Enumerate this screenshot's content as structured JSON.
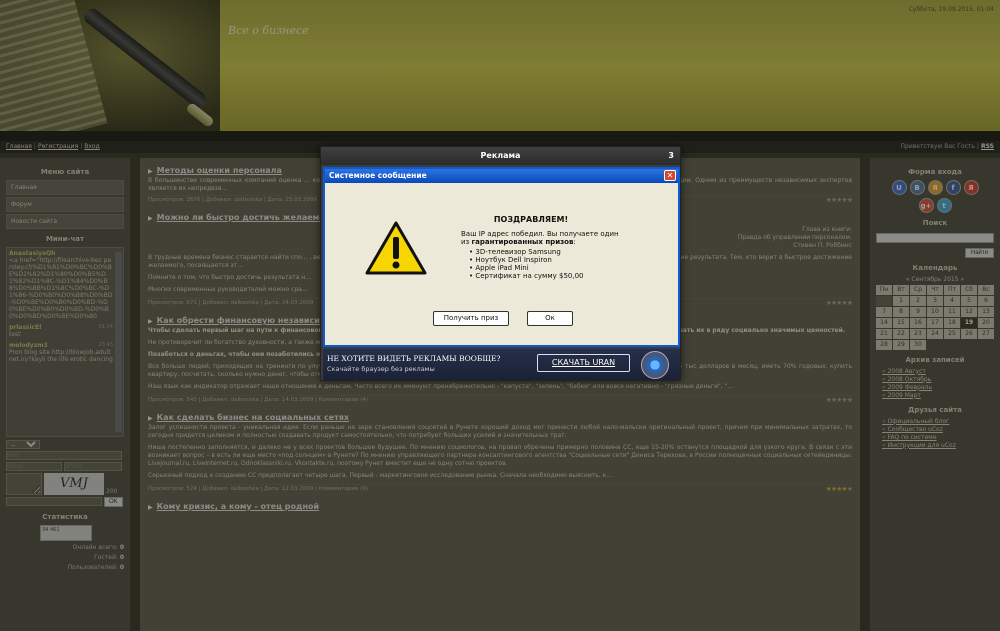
{
  "header": {
    "site_title": "Все о бизнесе",
    "date": "Суббота, 19.09.2015, 01:04"
  },
  "nav": {
    "items": [
      "Главная",
      "Регистрация",
      "Вход"
    ],
    "greeting": "Приветствую Вас Гость",
    "rss": "RSS"
  },
  "left": {
    "menu_title": "Меню сайта",
    "menu_items": [
      "Главная",
      "Форум",
      "Новости сайта"
    ],
    "chat_title": "Мини-чат",
    "chat_messages": [
      {
        "user": "AnastasiyaQh",
        "time": "",
        "text": "<a href=\"http://filearchive-bez paroley.cf/%D1%81%D0%BC%D0%BE%D1%82%D1%80%D0%B5%D1%82%D1%8C-%D1%84%D0%B8%D0%BB%D1%8C%D0%BC-%D1%86-%D0%B0%D0%B8%D0%BD-%D0%BE%D0%B0%D0%BD-%D0%BE%D0%B0%D0%BD-%D0%B0%D0%BD%D0%BE%D0%B0"
      },
      {
        "user": "prlassicEl",
        "time": "01:24",
        "text": "test"
      },
      {
        "user": "melodyzm3",
        "time": "23:43",
        "text": "Pron blog site http://blowjob.adultnet.in/?kayli the life erotic dancing"
      }
    ],
    "chat_select": "--",
    "name_placeholder": "Имя",
    "email_placeholder": "Email",
    "www_placeholder": "WWW",
    "captcha": "VMJ",
    "char_count": "200",
    "ok_label": "OK",
    "stats_title": "Статистика",
    "counter_text": "34 461",
    "stats": [
      {
        "label": "Онлайн всего:",
        "value": "0"
      },
      {
        "label": "Гостей:",
        "value": "0"
      },
      {
        "label": "Пользователей:",
        "value": "0"
      }
    ]
  },
  "articles": [
    {
      "title": "Методы оценки персонала",
      "body": "В большинстве современных компаний оценка ... комплексной оценки персонала кадровыми агентствам, которые располагают широким спект... и бизнес-ситуации. Одним из преимуществ независимых экспертов является их непредвзя... ",
      "more": "Читать дальше »",
      "footer": "Просмотров: 2676 | Добавил: dalbeshka | Дата: 25.03.2009",
      "stars": 0
    },
    {
      "title": "Можно ли быстро достичь желаемо",
      "quote": [
        "Глава из книги:",
        "Правда об управлении персоналом.",
        "Стивен П. Роббинс"
      ],
      "body": "В трудные времена бизнес старается найти спо... , велика популярность различных новаторских методик – управления персоналом, руководств... простое достижение результата. Тем, кто верит в быстрое достижение желаемого, посвящается эт...",
      "body2": "Помните о том, что быстро достичь результата н...",
      "body3": "Многих современных руководителей можно сра...",
      "footer": "Просмотров: 671 | Добавил: dalbeshka | Дата: 24.03.2009",
      "stars": 0
    },
    {
      "title": "Как обрести финансовую независи",
      "lead": "Чтобы сделать первый шаг на пути к финансовому успеху, взгляните другими глазами на такие понятия, как деньги и богатство, научитесь рассматривать их в ряду социально значимых ценностей.",
      "body": "Не противоречит ли богатство духовности, а также можно ли заработать миллион честным путем? Этим вопросом время от времени задается почти каждый из нас.",
      "subhead": "Позаботься о деньгах, чтобы они позаботились о тебе.",
      "body2": "Все больше людей, приходящих на тренинги по улучшению собственного благосостояния всегда очень разные интересы и ожидания: узнать, как зарабатывать 5 тыс долларов в месяц, иметь 70% годовых, купить квартиру, посчитать, сколько нужно денег, чтобы открыть свое дело.",
      "body3": "Наш язык как индикатор отражает наше отношение к деньгам. Часто всего их именуют пренебрежительно - \"капуста\", \"зелень\", \"бабки\" или вовсе негативно - \"грязные деньги\", \"...",
      "more": "Читать дальше »",
      "footer": "Просмотров: 545 | Добавил: dalbeshka | Дата: 14.03.2009 | Комментарии (4)",
      "stars": 0
    },
    {
      "title": "Как сделать бизнес на социальных сетях",
      "body": "Залог успешности проекта - уникальная идея. Если раньше на заре становления соцсетей в Рунете хороший доход мог принести любой нало-мальски оригинальный проект, причем при минимальных затратах, то сегодня придется целиком и полностью создавать продукт самостоятельно, что потребует больших усилий и значительных трат.",
      "body2": "Ниша постепенно заполняется, и далеко не у всех проектов большое будущее. По мнению социологов, на провал обречены примерно половина СС, еще 15-20% останутся площадкой для узкого круга. В связи с эти возникает вопрос – в есть ли еще место «под солнцем» в Рунете? По мнению управляющего партнера консалтингового агентства \"Социальные сети\" Дениса Терехова, в России полноценных социальных сетейединицы: LiveJournal.ru, LiveInternet.ru, Odnoklassniki.ru, Vkontakte.ru, поэтому Рунет вместит еще не одну сотню проектов.",
      "body3": "Серьезный подход к созданию СС предполагает четыре шага. Первый - маркетинговое исследование рынка. Сначала необходимо выяснить, к...",
      "more": "Читать дальше »",
      "footer": "Просмотров: 524 | Добавил: dalbeshka | Дата: 12.03.2009 | Комментарии (9)",
      "stars": 4
    },
    {
      "title": "Кому кризис, а кому - отец родной"
    }
  ],
  "right": {
    "login_title": "Форма входа",
    "social": [
      "U",
      "В",
      "Я",
      "f",
      "Я",
      "g+",
      "t"
    ],
    "social_colors": [
      "#3b6bd6",
      "#4f74a8",
      "#e0a020",
      "#3b5998",
      "#d43a2a",
      "#d94a38",
      "#33aadd"
    ],
    "search_title": "Поиск",
    "search_button": "Найти",
    "calendar_title": "Календарь",
    "calendar_month": "« Сентябрь 2015 »",
    "calendar_days": [
      "Пн",
      "Вт",
      "Ср",
      "Чт",
      "Пт",
      "Сб",
      "Вс"
    ],
    "calendar_offset": 1,
    "calendar_count": 30,
    "calendar_today": 19,
    "archive_title": "Архив записей",
    "archive": [
      "2008 Август",
      "2008 Октябрь",
      "2009 Февраль",
      "2009 Март"
    ],
    "friends_title": "Друзья сайта",
    "friends": [
      "Официальный блог",
      "Сообщество uCoz",
      "FAQ по системе",
      "Инструкции для uCoz"
    ]
  },
  "ad": {
    "header": "Реклама",
    "counter": "3",
    "dialog_title": "Системное сообщение",
    "heading": "ПОЗДРАВЛЯЕМ!",
    "line1": "Ваш IP адрес победил. Вы получаете один",
    "line2_prefix": "из ",
    "line2_bold": "гарантированных призов",
    "line2_suffix": ":",
    "prizes": [
      "3D-телевизор Samsung",
      "Ноутбук Dell Inspiron",
      "Apple iPad Mini",
      "Сертификат на сумму $50,00"
    ],
    "btn_get": "Получить приз",
    "btn_ok": "Ок",
    "bottom_title": "НЕ ХОТИТЕ ВИДЕТЬ РЕКЛАМЫ ВООБЩЕ?",
    "bottom_sub": "Скачайте браузер без рекламы",
    "uran_btn": "СКАЧАТЬ URAN"
  }
}
